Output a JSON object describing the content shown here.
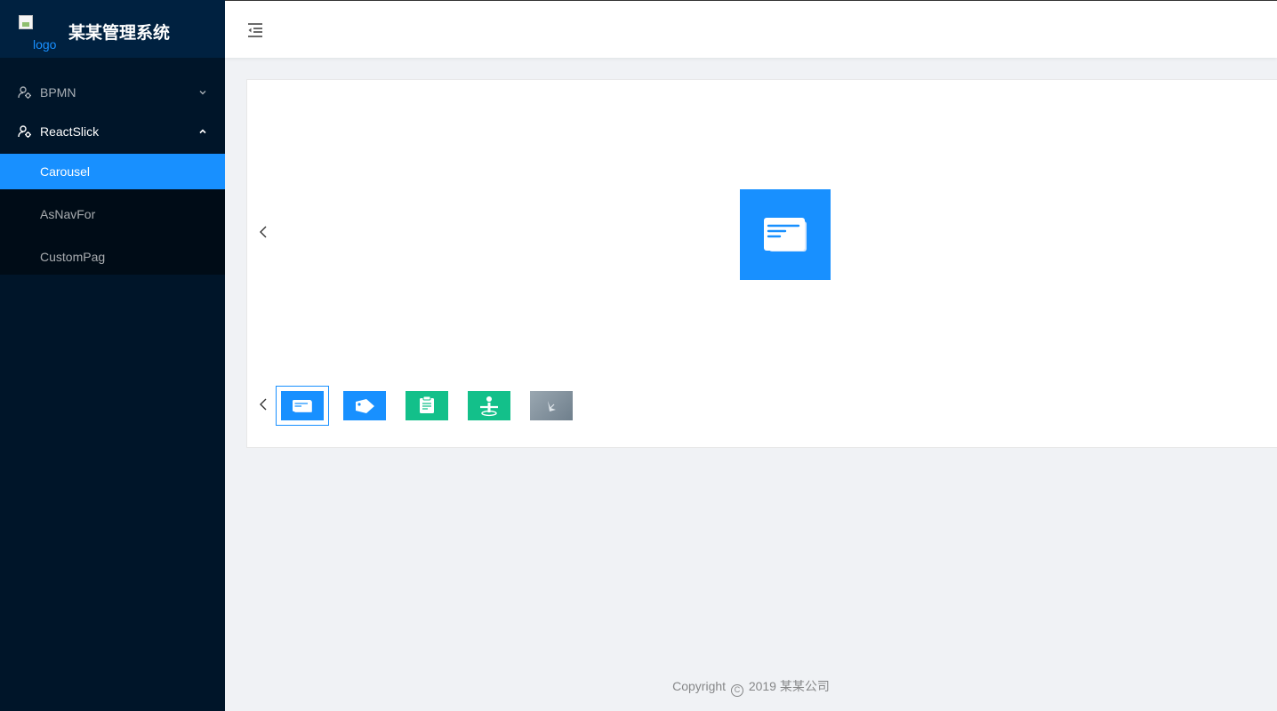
{
  "brand": {
    "logo_alt": "logo",
    "title": "某某管理系统"
  },
  "sidebar": {
    "menus": [
      {
        "label": "BPMN",
        "icon": "user-setting-icon",
        "expanded": false
      },
      {
        "label": "ReactSlick",
        "icon": "user-setting-icon",
        "expanded": true,
        "items": [
          {
            "label": "Carousel",
            "active": true
          },
          {
            "label": "AsNavFor",
            "active": false
          },
          {
            "label": "CustomPag",
            "active": false
          }
        ]
      }
    ]
  },
  "header": {
    "trigger_icon": "menu-fold-icon"
  },
  "carousel": {
    "main_slide_icon": "document-icon",
    "main_slide_color": "#1890ff",
    "thumbnails": [
      {
        "icon": "document-icon",
        "color": "#1890ff",
        "selected": true
      },
      {
        "icon": "tag-icon",
        "color": "#1890ff",
        "selected": false
      },
      {
        "icon": "clipboard-icon",
        "color": "#13c08a",
        "selected": false
      },
      {
        "icon": "person-icon",
        "color": "#13c08a",
        "selected": false
      },
      {
        "icon": "photo-icon",
        "color": "#8c9aa6",
        "selected": false
      }
    ]
  },
  "footer": {
    "prefix": "Copyright",
    "symbol": "C",
    "suffix": "2019 某某公司"
  },
  "colors": {
    "sider_bg": "#001529",
    "brand_bg": "#002140",
    "submenu_bg": "#000c17",
    "primary": "#1890ff",
    "content_bg": "#f0f2f5"
  }
}
